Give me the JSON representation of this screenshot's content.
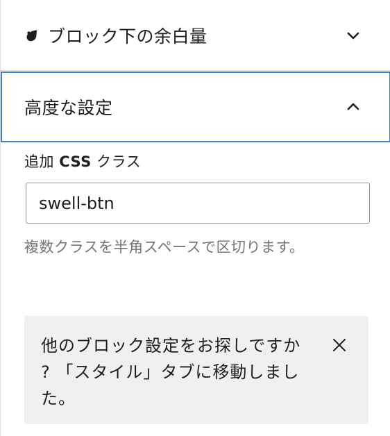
{
  "sections": {
    "spacing": {
      "title": "ブロック下の余白量",
      "icon": "droplet-icon",
      "chevron": "chevron-down-icon",
      "expanded": false
    },
    "advanced": {
      "title": "高度な設定",
      "chevron": "chevron-up-icon",
      "expanded": true,
      "focused": true
    }
  },
  "advanced_settings": {
    "css_label_prefix": "追加",
    "css_label_bold": "CSS",
    "css_label_suffix": "クラス",
    "css_input_value": "swell-btn",
    "help_text": "複数クラスを半角スペースで区切ります。"
  },
  "notice": {
    "message": "他のブロック設定をお探しですか ? 「スタイル」タブに移動しました。",
    "close_icon": "close-icon"
  },
  "colors": {
    "focus_border": "#3b82c4",
    "notice_bg": "#f0f0f0",
    "help_text": "#757575"
  }
}
